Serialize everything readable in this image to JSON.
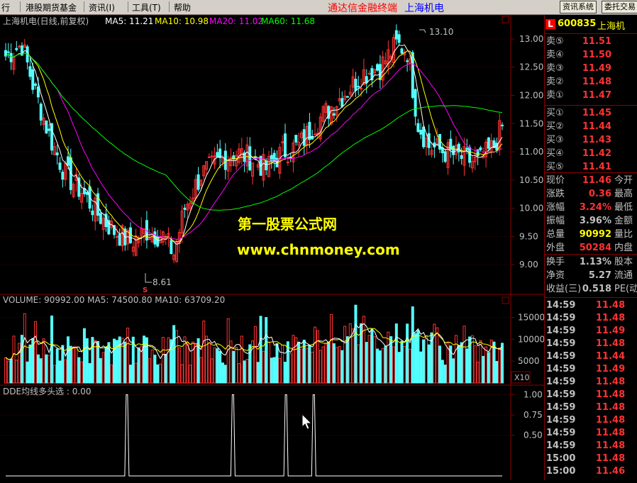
{
  "menu": {
    "items": [
      "行",
      "港股期货基金",
      "资讯(I)",
      "工具(T)",
      "帮助"
    ],
    "promo1": "通达信金融终端",
    "promo2": "上海机电",
    "btn_info": "资讯系统",
    "btn_trade": "委托交易"
  },
  "colors": {
    "up": "#ff3232",
    "down": "#54ffff",
    "ma5": "#ffffff",
    "ma10": "#ffff00",
    "ma20": "#ff00ff",
    "ma60": "#00ff00",
    "axis": "#8b0000",
    "label": "#c0c0c0",
    "watermark": "#ffff00"
  },
  "main_chart": {
    "title": "上海机电(日线,前复权)",
    "ma_labels": [
      "MA5: 11.21",
      "MA10: 10.98",
      "MA20: 11.02",
      "MA60: 11.68"
    ],
    "high_label": "13.10",
    "low_label": "8.61",
    "marker": "S",
    "yticks": [
      "13.00",
      "12.50",
      "12.00",
      "11.50",
      "11.00",
      "10.50",
      "10.00",
      "9.50",
      "9.00"
    ]
  },
  "watermark": {
    "line1": "第一股票公式网",
    "line2": "www.chnmoney.com"
  },
  "volume_chart": {
    "title": "VOLUME: 90992.00  MA5: 74500.80  MA10: 63709.20",
    "yticks": [
      "15000",
      "10000",
      "5000"
    ],
    "unit": "X10"
  },
  "dde_chart": {
    "title": "DDE均线多头选 : 0.00",
    "yticks": [
      "1.00",
      "0.75",
      "0.50"
    ]
  },
  "quote": {
    "logo": "L",
    "code": "600835",
    "name": "上海机",
    "asks": [
      {
        "label": "卖⑤",
        "price": "11.51"
      },
      {
        "label": "卖④",
        "price": "11.50"
      },
      {
        "label": "卖③",
        "price": "11.49"
      },
      {
        "label": "卖②",
        "price": "11.48"
      },
      {
        "label": "卖①",
        "price": "11.47"
      }
    ],
    "bids": [
      {
        "label": "买①",
        "price": "11.45"
      },
      {
        "label": "买②",
        "price": "11.44"
      },
      {
        "label": "买③",
        "price": "11.43"
      },
      {
        "label": "买④",
        "price": "11.42"
      },
      {
        "label": "买⑤",
        "price": "11.41"
      }
    ],
    "stats": [
      {
        "label": "现价",
        "value": "11.46",
        "extra": "今开",
        "color": "#ff3232"
      },
      {
        "label": "涨跌",
        "value": "0.36",
        "extra": "最高",
        "color": "#ff3232"
      },
      {
        "label": "涨幅",
        "value": "3.24%",
        "extra": "最低",
        "color": "#ff3232"
      },
      {
        "label": "振幅",
        "value": "3.96%",
        "extra": "金额",
        "color": "#c0c0c0"
      },
      {
        "label": "总量",
        "value": "90992",
        "extra": "量比",
        "color": "#ffff00"
      },
      {
        "label": "外盘",
        "value": "50284",
        "extra": "内盘",
        "color": "#ff3232"
      }
    ],
    "stats2": [
      {
        "label": "换手",
        "value": "1.13%",
        "extra": "股本",
        "color": "#c0c0c0"
      },
      {
        "label": "净资",
        "value": "5.27",
        "extra": "流通",
        "color": "#c0c0c0"
      },
      {
        "label": "收益(三)",
        "value": "0.518",
        "extra": "PE(动",
        "color": "#c0c0c0"
      }
    ],
    "ticks": [
      {
        "time": "14:59",
        "price": "11.48"
      },
      {
        "time": "14:59",
        "price": "11.48"
      },
      {
        "time": "14:59",
        "price": "11.49"
      },
      {
        "time": "14:59",
        "price": "11.48"
      },
      {
        "time": "14:59",
        "price": "11.44"
      },
      {
        "time": "14:59",
        "price": "11.49"
      },
      {
        "time": "14:59",
        "price": "11.48"
      },
      {
        "time": "14:59",
        "price": "11.48"
      },
      {
        "time": "14:59",
        "price": "11.48"
      },
      {
        "time": "14:59",
        "price": "11.48"
      },
      {
        "time": "14:59",
        "price": "11.48"
      },
      {
        "time": "14:59",
        "price": "11.48"
      },
      {
        "time": "15:00",
        "price": "11.48"
      },
      {
        "time": "15:00",
        "price": "11.46"
      }
    ]
  },
  "chart_data": [
    {
      "type": "candlestick",
      "title": "上海机电(日线,前复权)",
      "ylim": [
        8.5,
        13.25
      ],
      "high": 13.1,
      "low": 8.61,
      "close_keypoints": [
        [
          0,
          12.7
        ],
        [
          6,
          12.9
        ],
        [
          10,
          12.2
        ],
        [
          16,
          11.3
        ],
        [
          22,
          10.6
        ],
        [
          28,
          10.3
        ],
        [
          34,
          9.9
        ],
        [
          40,
          9.6
        ],
        [
          46,
          9.4
        ],
        [
          52,
          9.6
        ],
        [
          58,
          9.5
        ],
        [
          62,
          9.2
        ],
        [
          66,
          10.0
        ],
        [
          72,
          10.6
        ],
        [
          78,
          10.8
        ],
        [
          84,
          11.0
        ],
        [
          90,
          10.9
        ],
        [
          96,
          10.7
        ],
        [
          102,
          11.0
        ],
        [
          108,
          11.1
        ],
        [
          114,
          11.5
        ],
        [
          120,
          11.8
        ],
        [
          126,
          12.1
        ],
        [
          132,
          12.4
        ],
        [
          138,
          12.5
        ],
        [
          144,
          12.9
        ],
        [
          148,
          12.8
        ],
        [
          152,
          11.5
        ],
        [
          156,
          11.1
        ],
        [
          162,
          11.0
        ],
        [
          168,
          10.9
        ],
        [
          174,
          10.8
        ],
        [
          180,
          11.1
        ],
        [
          183,
          11.46
        ]
      ]
    },
    {
      "type": "bar",
      "title": "VOLUME",
      "ylim": [
        0,
        18000
      ],
      "latest": 90992,
      "ma5": 74500.8,
      "ma10": 63709.2
    },
    {
      "type": "line",
      "title": "DDE均线多头选",
      "ylim": [
        0,
        1.1
      ],
      "spike_positions": [
        0.24,
        0.45,
        0.555,
        0.61
      ]
    }
  ]
}
